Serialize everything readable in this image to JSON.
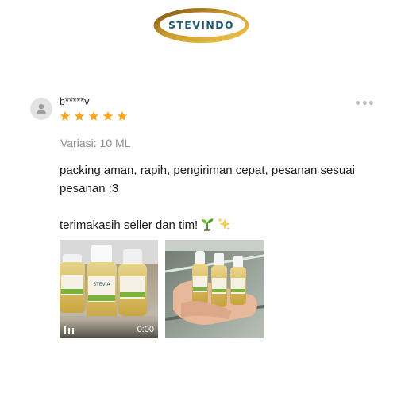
{
  "brand": {
    "logo_text": "STEVINDO",
    "colors": {
      "ring": "#c99a2e",
      "ring_dark": "#7a4a12",
      "text": "#1f5a70"
    }
  },
  "review": {
    "username": "b*****v",
    "rating": 5,
    "rating_max": 5,
    "star_color": "#f5a623",
    "variant_label": "Variasi",
    "variant_value": "10 ML",
    "comment_lines": [
      "packing aman, rapih, pengiriman cepat, pesanan sesuai pesanan :3",
      "terimakasih seller dan tim!"
    ],
    "emojis": [
      "seedling-emoji",
      "sparkles-emoji"
    ],
    "media": [
      {
        "type": "video",
        "duration": "0:00",
        "icon": "video-icon"
      },
      {
        "type": "photo"
      }
    ],
    "more_icon": "more-options-icon"
  }
}
